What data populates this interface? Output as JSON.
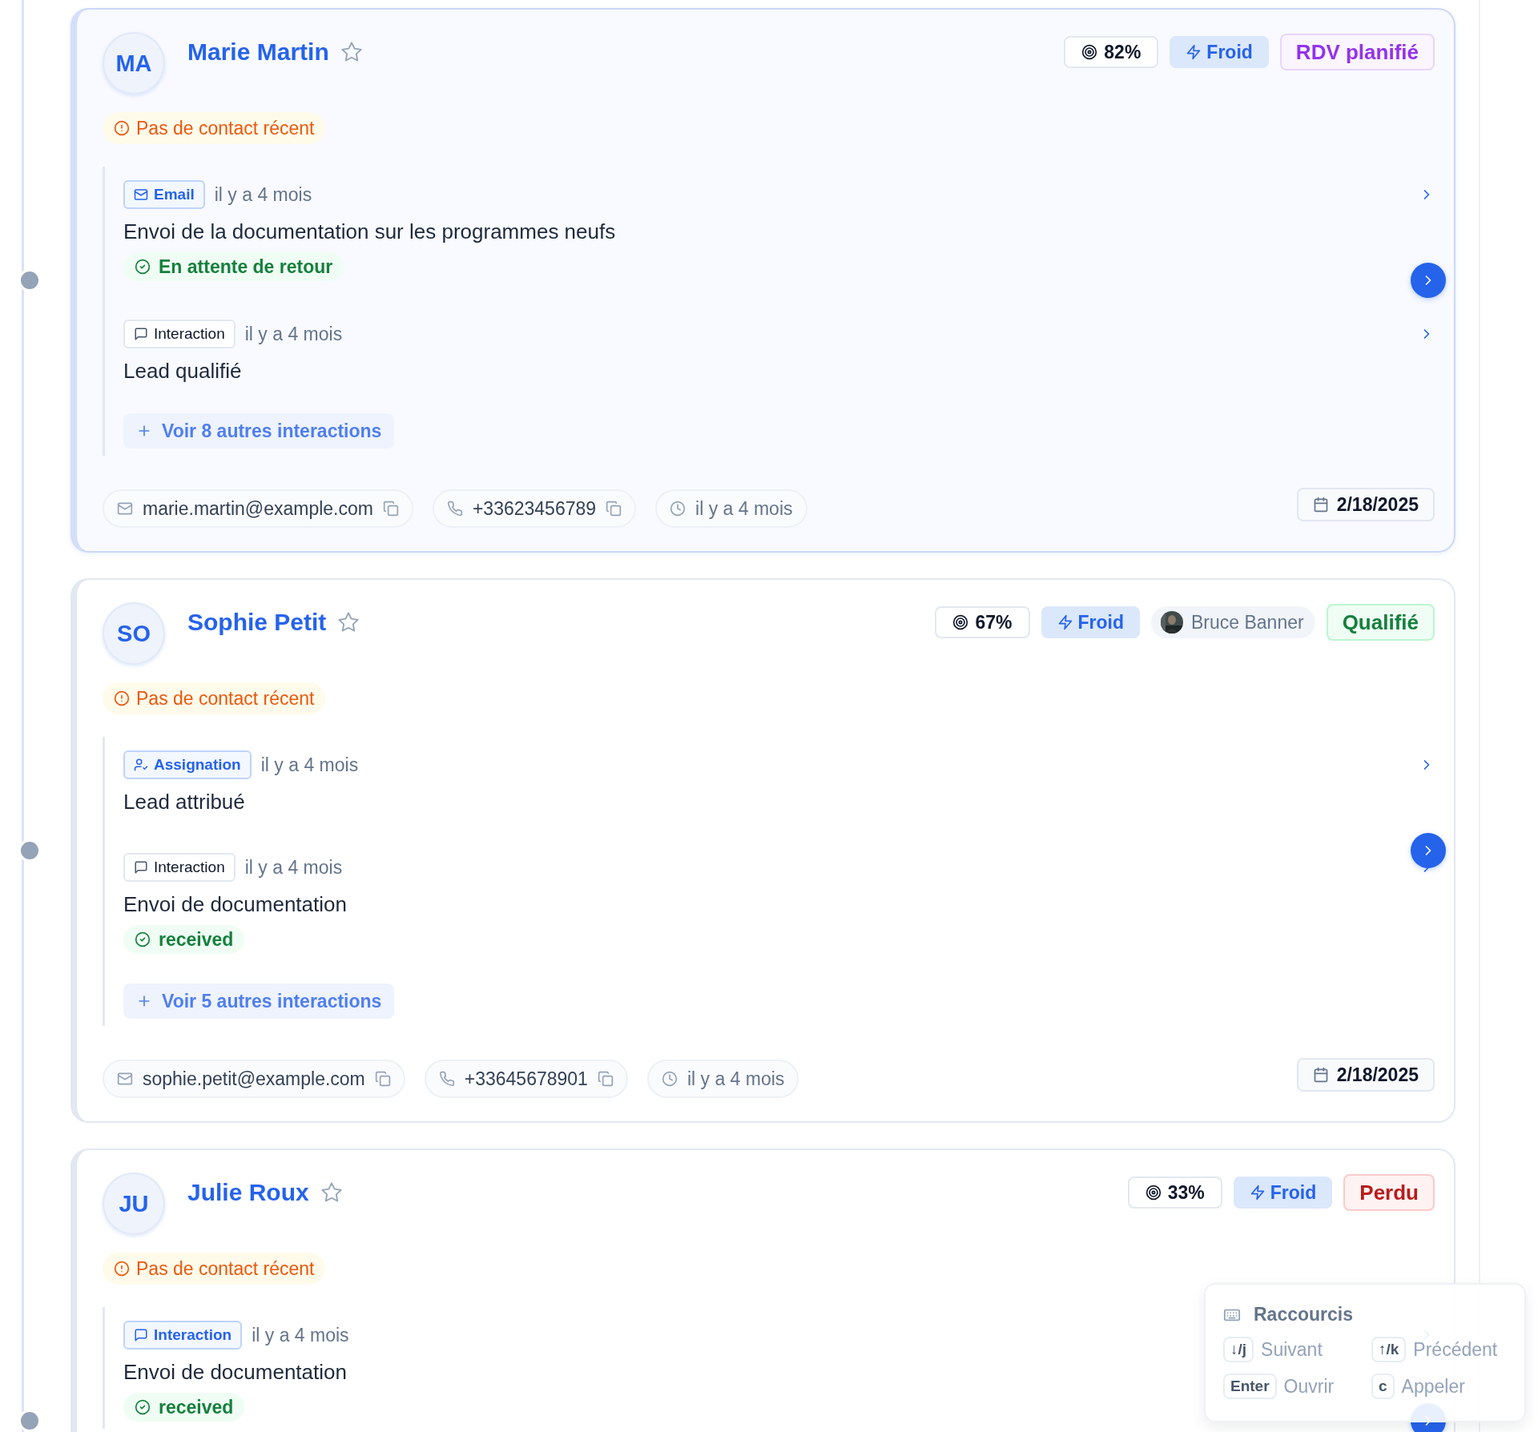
{
  "leads": [
    {
      "initials": "MA",
      "name": "Marie Martin",
      "favorite": false,
      "selected": true,
      "score": "82%",
      "temperature": "Froid",
      "status": {
        "label": "RDV planifié",
        "kind": "scheduled"
      },
      "alert": "Pas de contact récent",
      "interactions": [
        {
          "tag": {
            "label": "Email",
            "kind": "email",
            "highlighted": true
          },
          "time": "il y a 4 mois",
          "title": "Envoi de la documentation sur les programmes neufs",
          "status": "En attente de retour"
        },
        {
          "tag": {
            "label": "Interaction",
            "kind": "interaction",
            "highlighted": false
          },
          "time": "il y a 4 mois",
          "title": "Lead qualifié"
        }
      ],
      "more_button": "Voir 8 autres interactions",
      "email": "marie.martin@example.com",
      "phone": "+33623456789",
      "last_contact": "il y a 4 mois",
      "date": "2/18/2025"
    },
    {
      "initials": "SO",
      "name": "Sophie Petit",
      "favorite": false,
      "selected": false,
      "score": "67%",
      "temperature": "Froid",
      "assignee": "Bruce Banner",
      "status": {
        "label": "Qualifié",
        "kind": "qualified"
      },
      "alert": "Pas de contact récent",
      "interactions": [
        {
          "tag": {
            "label": "Assignation",
            "kind": "assignment",
            "highlighted": true
          },
          "time": "il y a 4 mois",
          "title": "Lead attribué"
        },
        {
          "tag": {
            "label": "Interaction",
            "kind": "interaction",
            "highlighted": false
          },
          "time": "il y a 4 mois",
          "title": "Envoi de documentation",
          "status": "received"
        }
      ],
      "more_button": "Voir 5 autres interactions",
      "email": "sophie.petit@example.com",
      "phone": "+33645678901",
      "last_contact": "il y a 4 mois",
      "date": "2/18/2025"
    },
    {
      "initials": "JU",
      "name": "Julie Roux",
      "favorite": false,
      "selected": false,
      "score": "33%",
      "temperature": "Froid",
      "status": {
        "label": "Perdu",
        "kind": "lost"
      },
      "alert": "Pas de contact récent",
      "interactions": [
        {
          "tag": {
            "label": "Interaction",
            "kind": "interaction",
            "highlighted": true
          },
          "time": "il y a 4 mois",
          "title": "Envoi de documentation",
          "status": "received"
        }
      ]
    }
  ],
  "shortcuts": {
    "title": "Raccourcis",
    "items": [
      {
        "key": "↓/j",
        "label": "Suivant"
      },
      {
        "key": "↑/k",
        "label": "Précédent"
      },
      {
        "key": "Enter",
        "label": "Ouvrir"
      },
      {
        "key": "c",
        "label": "Appeler"
      }
    ]
  }
}
